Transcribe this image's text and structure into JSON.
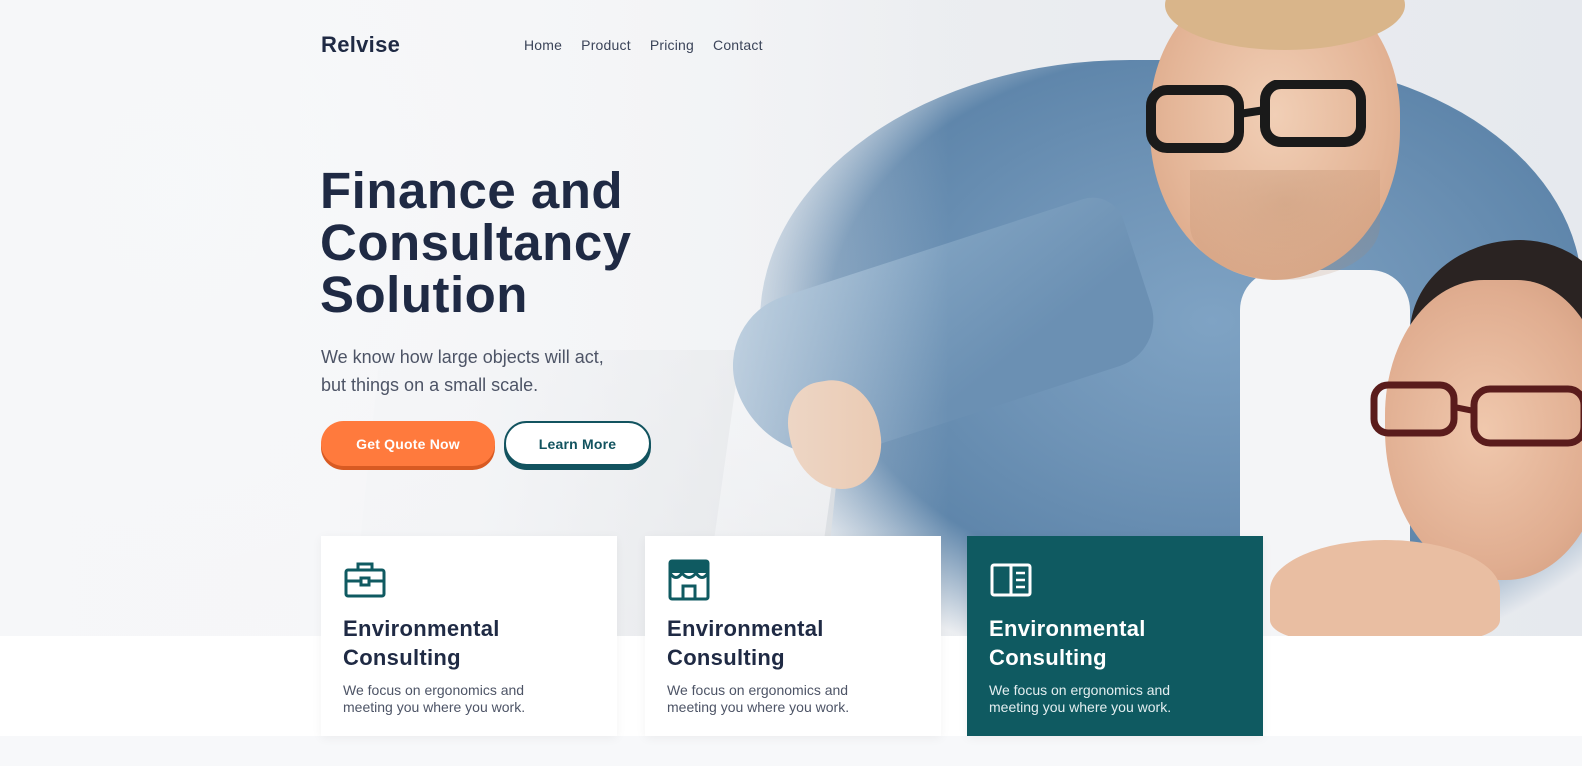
{
  "brand": {
    "name": "Relvise"
  },
  "nav": {
    "items": [
      "Home",
      "Product",
      "Pricing",
      "Contact"
    ]
  },
  "hero": {
    "headline": [
      "Finance and",
      "Consultancy",
      "Solution"
    ],
    "subtext": [
      "We know how large objects will act,",
      "but things on a small scale."
    ],
    "primary_button": "Get Quote Now",
    "secondary_button": "Learn More"
  },
  "cards": [
    {
      "icon": "briefcase-icon",
      "title": [
        "Environmental",
        "Consulting"
      ],
      "desc": "We focus on ergonomics and meeting you where you work."
    },
    {
      "icon": "storefront-icon",
      "title": [
        "Environmental",
        "Consulting"
      ],
      "desc": "We focus on ergonomics and meeting you where you work."
    },
    {
      "icon": "book-open-icon",
      "title": [
        "Environmental",
        "Consulting"
      ],
      "desc": "We focus on ergonomics and meeting you where you work."
    }
  ],
  "colors": {
    "primary": "#ff7a3d",
    "teal": "#0f5a61",
    "heading": "#1f2a44"
  }
}
